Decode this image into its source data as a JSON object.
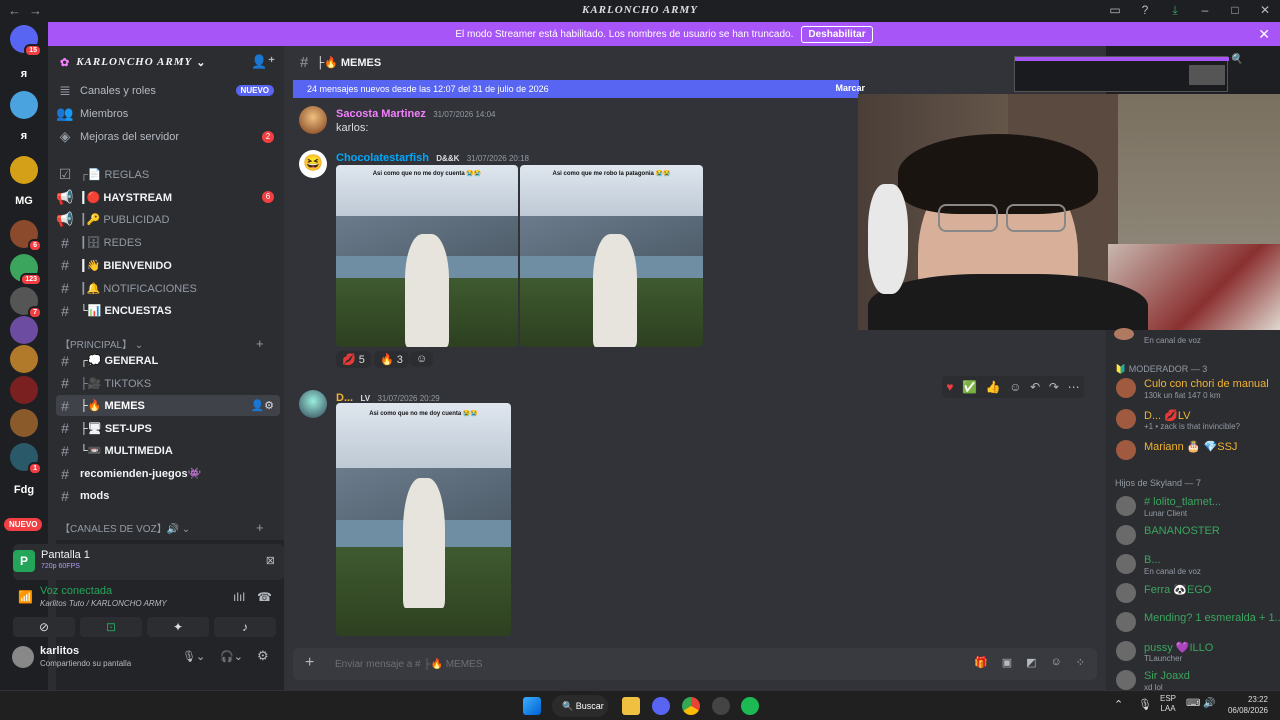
{
  "titlebar": {
    "title": "KARLONCHO ARMY"
  },
  "banner": {
    "text": "El modo Streamer está habilitado. Los nombres de usuario se han truncado.",
    "button": "Deshabilitar"
  },
  "servers": [
    {
      "label": "",
      "badge": "15",
      "color": "#5865f2"
    },
    {
      "label": "ᴙ",
      "badge": "",
      "color": "#1e1f22"
    },
    {
      "label": "",
      "badge": "",
      "color": "#4aa3df"
    },
    {
      "label": "ᴙ",
      "badge": "",
      "color": "#1e1f22"
    },
    {
      "label": "",
      "badge": "",
      "color": "#d4a017"
    },
    {
      "label": "MG",
      "badge": "",
      "color": "#1e1f22"
    },
    {
      "label": "",
      "badge": "6",
      "color": "#8b4a2b"
    },
    {
      "label": "",
      "badge": "123",
      "color": "#3ba55d"
    },
    {
      "label": "",
      "badge": "7",
      "color": "#555"
    },
    {
      "label": "",
      "badge": "",
      "color": "#6b4ca0"
    },
    {
      "label": "",
      "badge": "",
      "color": "#b07a2a"
    },
    {
      "label": "",
      "badge": "",
      "color": "#7a2020"
    },
    {
      "label": "",
      "badge": "",
      "color": "#8a5a2a"
    },
    {
      "label": "",
      "badge": "1",
      "color": "#2a5a6a"
    },
    {
      "label": "Fdg",
      "badge": "",
      "color": "#1e1f22"
    }
  ],
  "new_tag": "NUEVO",
  "sidebar": {
    "server_name": "KARLONCHO ARMY",
    "top_items": [
      {
        "icon": "≣",
        "label": "Canales y roles",
        "tag": "NUEVO"
      },
      {
        "icon": "👥",
        "label": "Miembros",
        "tag": ""
      },
      {
        "icon": "◈",
        "label": "Mejoras del servidor",
        "count": "2"
      }
    ],
    "channels": [
      {
        "icon": "☑",
        "label": "┌📄 REGLAS",
        "bold": false,
        "count": ""
      },
      {
        "icon": "📢",
        "label": "┃🔴 HAYSTREAM",
        "bold": true,
        "count": "6"
      },
      {
        "icon": "📢",
        "label": "┃🔑 PUBLICIDAD",
        "bold": false,
        "count": ""
      },
      {
        "icon": "#",
        "label": "┃🗄 REDES",
        "bold": false,
        "count": ""
      },
      {
        "icon": "#",
        "label": "┃👋 BIENVENIDO",
        "bold": true,
        "count": ""
      },
      {
        "icon": "#",
        "label": "┃🔔 NOTIFICACIONES",
        "bold": false,
        "count": ""
      },
      {
        "icon": "#",
        "label": "└📊 ENCUESTAS",
        "bold": true,
        "count": ""
      }
    ],
    "category_principal": "【PRINCIPAL】",
    "channels2": [
      {
        "icon": "#",
        "label": "┌💭 GENERAL",
        "bold": true
      },
      {
        "icon": "#",
        "label": "├🎥 TIKTOKS",
        "bold": false
      },
      {
        "icon": "#",
        "label": "├🔥 MEMES",
        "bold": true,
        "selected": true
      },
      {
        "icon": "#",
        "label": "├🖥 SET-UPS",
        "bold": true
      },
      {
        "icon": "#",
        "label": "└📼 MULTIMEDIA",
        "bold": true
      },
      {
        "icon": "#",
        "label": "recomienden-juegos👾",
        "bold": true
      },
      {
        "icon": "#",
        "label": "mods",
        "bold": true
      }
    ],
    "category_voz": "【CANALES DE VOZ】🔊"
  },
  "voice": {
    "screen_title": "Pantalla 1",
    "screen_sub": "720p 60FPS",
    "status": "Voz conectada",
    "location": "Karlitos Tuto / KARLONCHO ARMY",
    "user": "karlitos",
    "user_status": "Compartiendo su pantalla"
  },
  "chat": {
    "channel": "├🔥 MEMES",
    "new_messages": "24 mensajes nuevos desde las 12:07 del 31 de julio de 2026",
    "mark_read": "Marcar",
    "messages": [
      {
        "author": "Sacosta Martinez",
        "color": "#f47fff",
        "time": "31/07/2026 14:04",
        "text": "karlos:"
      },
      {
        "author": "Chocolatestarfish",
        "color": "#00a8fc",
        "tag": "D&&K",
        "time": "31/07/2026 20:18",
        "caption": "Asi como que no me doy cuenta 😭😭",
        "caption2": "Asi como que me robo la patagonia 😭😭"
      },
      {
        "author": "D...",
        "color": "#f0b232",
        "tag": "LV",
        "time": "31/07/2026 20:29",
        "caption": "Asi como que no me doy cuenta 😭😭"
      }
    ],
    "reactions": [
      {
        "emoji": "💋",
        "count": "5"
      },
      {
        "emoji": "🔥",
        "count": "3"
      },
      {
        "emoji": "☺",
        "count": ""
      }
    ],
    "input_placeholder": "Enviar mensaje a # ├🔥 MEMES"
  },
  "members": {
    "top_status": "En canal de voz",
    "group_mod": "MODERADOR — 3",
    "mods": [
      {
        "name": "Culo con chori de manual",
        "status": "130k un fiat 147 0 km",
        "color": "#f0b232"
      },
      {
        "name": "D... 💋LV",
        "status": "+1 • zack is that invincible?",
        "color": "#f0b232"
      },
      {
        "name": "Mariann 🎂 💎SSJ",
        "status": "",
        "color": "#f0b232"
      }
    ],
    "group_sky": "Hijos de Skyland — 7",
    "sky": [
      {
        "name": "# lolito_tlamet...",
        "status": "Lunar Client",
        "color": "#3ba55d"
      },
      {
        "name": "BANANOSTER",
        "status": "",
        "color": "#3ba55d"
      },
      {
        "name": "B...",
        "status": "En canal de voz",
        "color": "#3ba55d"
      },
      {
        "name": "Ferra 🐼EGO",
        "status": "",
        "color": "#3ba55d"
      },
      {
        "name": "Mending? 1 esmeralda + 1...",
        "status": "",
        "color": "#3ba55d"
      },
      {
        "name": "pussy 💜ILLO",
        "status": "TLauncher",
        "color": "#3ba55d"
      },
      {
        "name": "Sir Joaxd",
        "status": "xd lol",
        "color": "#3ba55d"
      }
    ]
  },
  "taskbar": {
    "search": "Buscar",
    "lang1": "ESP",
    "lang2": "LAA",
    "time": "23:22",
    "date": "06/08/2026"
  }
}
